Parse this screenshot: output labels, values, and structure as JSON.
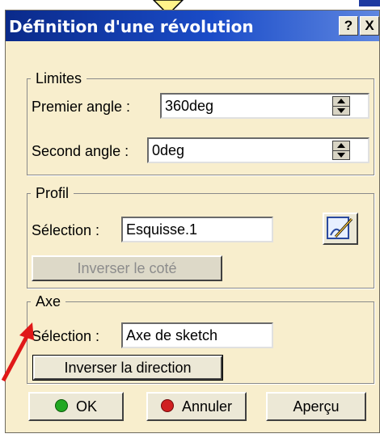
{
  "window": {
    "title": "Définition d'une révolution"
  },
  "titlebar": {
    "help_label": "?",
    "close_label": "X"
  },
  "limites": {
    "legend": "Limites",
    "premier": {
      "label": "Premier angle :",
      "value": "360deg"
    },
    "second": {
      "label": "Second angle :",
      "value": "0deg"
    }
  },
  "profil": {
    "legend": "Profil",
    "selection_label": "Sélection :",
    "selection_value": "Esquisse.1",
    "sketch_icon": "sketch-pencil-icon",
    "inverser_cote_label": "Inverser le coté"
  },
  "axe": {
    "legend": "Axe",
    "selection_label": "Sélection :",
    "selection_value": "Axe de sketch",
    "inverser_direction_label": "Inverser la direction"
  },
  "footer": {
    "ok_label": "OK",
    "annuler_label": "Annuler",
    "apercu_label": "Aperçu"
  },
  "colors": {
    "dialog_bg": "#f8eecd",
    "titlebar": "#1a4cc8",
    "ok_dot": "#22a822",
    "annuler_dot": "#d02020",
    "annotation_arrow": "#e01818",
    "callout": "#fff38a"
  }
}
